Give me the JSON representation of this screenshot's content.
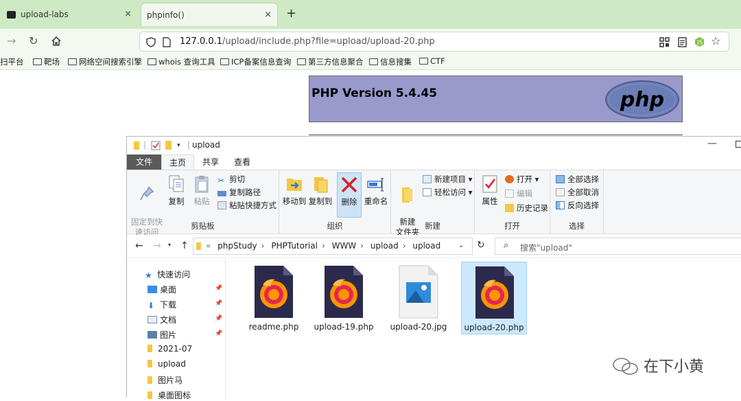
{
  "browser": {
    "tabs": [
      {
        "label": "upload-labs",
        "close": "×"
      },
      {
        "label": "phpinfo()",
        "close": "×"
      }
    ],
    "new_tab": "+",
    "url": {
      "host": "127.0.0.1",
      "path": "/upload/include.php?file=upload/upload-20.php"
    },
    "bookmarks": [
      "扫平台",
      "靶场",
      "网络空间搜索引擎",
      "whois 查询工具",
      "ICP备案信息查询",
      "第三方信息聚合",
      "信息搜集",
      "CTF"
    ]
  },
  "phpinfo": {
    "version": "PHP Version 5.4.45",
    "logo_text": "php"
  },
  "explorer": {
    "title": "upload",
    "ribbon_tabs": [
      "文件",
      "主页",
      "共享",
      "查看"
    ],
    "clipboard": {
      "label": "剪贴板",
      "pin": "固定到快\n速访问",
      "copy": "复制",
      "paste": "粘贴",
      "cut": "剪切",
      "copy_path": "复制路径",
      "paste_shortcut": "粘贴快捷方式"
    },
    "organize": {
      "label": "组织",
      "move_to": "移动到",
      "copy_to": "复制到",
      "delete": "删除",
      "rename": "重命名"
    },
    "new": {
      "label": "新建",
      "new_folder": "新建\n文件夹",
      "new_item": "新建项目",
      "easy_access": "轻松访问"
    },
    "open": {
      "label": "打开",
      "properties": "属性",
      "open": "打开",
      "edit": "编辑",
      "history": "历史记录"
    },
    "select": {
      "label": "选择",
      "select_all": "全部选择",
      "select_none": "全部取消",
      "invert": "反向选择"
    },
    "breadcrumb": [
      "«",
      "phpStudy",
      "PHPTutorial",
      "WWW",
      "upload",
      "upload"
    ],
    "search_placeholder": "搜索\"upload\"",
    "nav": [
      {
        "label": "快速访问",
        "pinned": false
      },
      {
        "label": "桌面",
        "pinned": true
      },
      {
        "label": "下载",
        "pinned": true
      },
      {
        "label": "文档",
        "pinned": true
      },
      {
        "label": "图片",
        "pinned": true
      },
      {
        "label": "2021-07",
        "pinned": false
      },
      {
        "label": "upload",
        "pinned": false
      },
      {
        "label": "图片马",
        "pinned": false
      },
      {
        "label": "桌面图标",
        "pinned": false
      }
    ],
    "files": [
      {
        "name": "readme.php",
        "type": "php"
      },
      {
        "name": "upload-19.php",
        "type": "php"
      },
      {
        "name": "upload-20.jpg",
        "type": "jpg"
      },
      {
        "name": "upload-20.php",
        "type": "php",
        "selected": true
      }
    ]
  },
  "watermark": "在下小黄",
  "colors": {
    "browser_bg": "#cdeac4",
    "php_header": "#9999cc",
    "ribbon_file_tab": "#5a5a5a",
    "selection": "#cce8ff",
    "delete_x": "#d6202b"
  }
}
